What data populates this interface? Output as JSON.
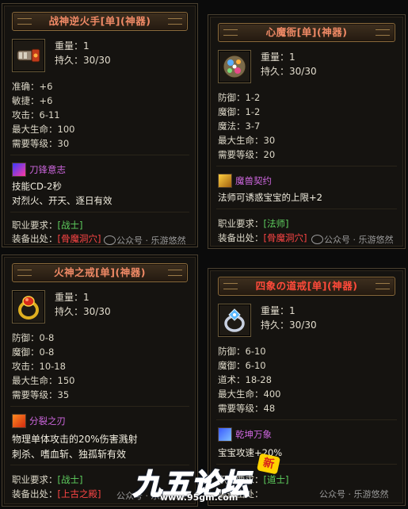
{
  "panels": [
    {
      "title": "战神逆火手[单](神器)",
      "weight": "重量：1",
      "durability": "持久：30/30",
      "stats": [
        "准确：+6",
        "敏捷：+6",
        "攻击：6-11",
        "最大生命：100",
        "需要等级：30"
      ],
      "skill_name": "刀锋意志",
      "skill_desc": [
        "技能CD-2秒",
        "对烈火、开天、逐日有效"
      ],
      "job_label": "职业要求：",
      "job_value": "[战士]",
      "source_label": "装备出处：",
      "source_value": "[骨魔洞穴]",
      "watermark": "公众号 · 乐游悠然"
    },
    {
      "title": "心魔衙[单](神器)",
      "weight": "重量：1",
      "durability": "持久：30/30",
      "stats": [
        "防御：1-2",
        "魔御：1-2",
        "魔法：3-7",
        "最大生命：30",
        "需要等级：20"
      ],
      "skill_name": "魔兽契约",
      "skill_desc": [
        "法师可诱惑宝宝的上限+2"
      ],
      "job_label": "职业要求：",
      "job_value": "[法师]",
      "source_label": "装备出处：",
      "source_value": "[骨魔洞穴]",
      "watermark": "公众号 · 乐游悠然"
    },
    {
      "title": "火神之戒[单](神器)",
      "weight": "重量：1",
      "durability": "持久：30/30",
      "stats": [
        "防御：0-8",
        "魔御：0-8",
        "攻击：10-18",
        "最大生命：150",
        "需要等级：35"
      ],
      "skill_name": "分裂之刃",
      "skill_desc": [
        "物理单体攻击的20%伤害溅射",
        "刺杀、嗜血斩、独孤斩有效"
      ],
      "job_label": "职业要求：",
      "job_value": "[战士]",
      "source_label": "装备出处：",
      "source_value": "[上古之殿]",
      "watermark": "公众号 · 乐游悠然"
    },
    {
      "title": "四象の道戒[单](神器)",
      "weight": "重量：1",
      "durability": "持久：30/30",
      "stats": [
        "防御：6-10",
        "魔御：6-10",
        "道术：18-28",
        "最大生命：400",
        "需要等级：48"
      ],
      "skill_name": "乾坤万象",
      "skill_desc": [
        "宝宝攻速+20%"
      ],
      "job_label": "职业要求：",
      "job_value": "[道士]",
      "source_label": "装备出处：",
      "source_value": "",
      "watermark": "公众号 · 乐游悠然"
    }
  ],
  "logo": {
    "text": "九五论坛",
    "url": "www.95gm.com",
    "badge": "新"
  },
  "colors": {
    "title": "#f08a66",
    "title_red": "#ff4a3a",
    "skill": "#cc66dd",
    "job": "#5fd05f",
    "source": "#ff4545",
    "logo_blue": "#2f8cff"
  },
  "icons": [
    "gauntlet-icon",
    "gem-orb-icon",
    "fire-ring-icon",
    "crystal-ring-icon",
    "blade-skill-icon",
    "beast-skill-icon",
    "split-blade-skill-icon",
    "cosmos-skill-icon",
    "wechat-icon"
  ]
}
